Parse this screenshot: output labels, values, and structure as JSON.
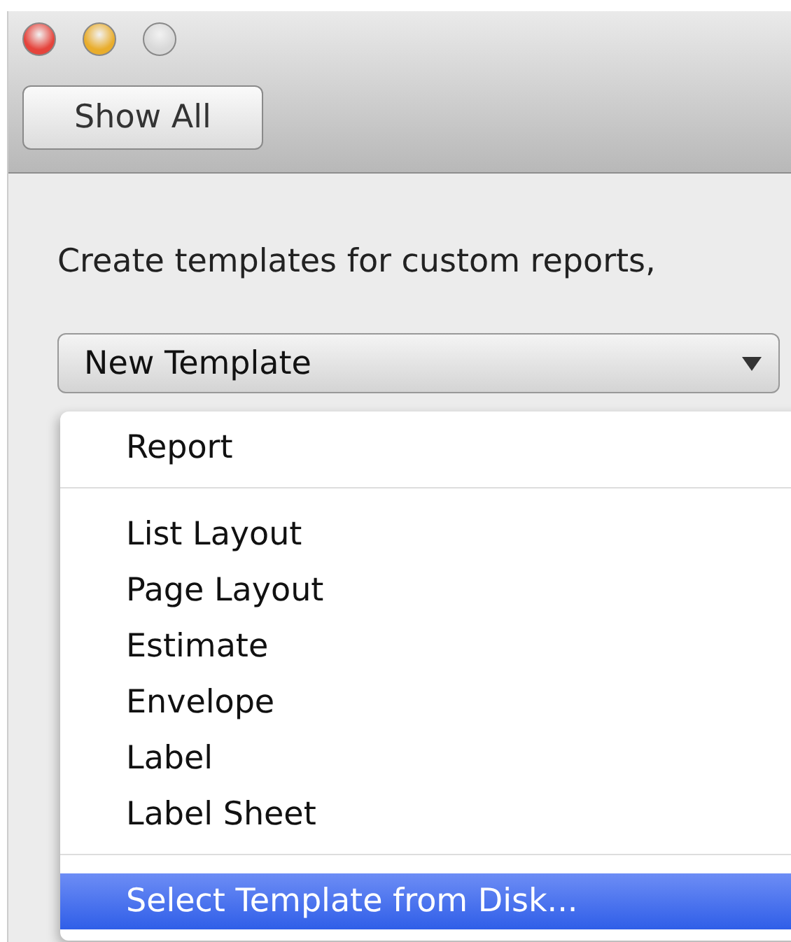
{
  "toolbar": {
    "show_all_button": "Show All"
  },
  "description": "Create templates for custom reports,",
  "template_popup": {
    "value": "New Template",
    "expanded": true
  },
  "menu": [
    {
      "kind": "item",
      "label": "Report",
      "selected": false
    },
    {
      "kind": "separator"
    },
    {
      "kind": "item",
      "label": "List Layout",
      "selected": false
    },
    {
      "kind": "item",
      "label": "Page Layout",
      "selected": false
    },
    {
      "kind": "item",
      "label": "Estimate",
      "selected": false
    },
    {
      "kind": "item",
      "label": "Envelope",
      "selected": false
    },
    {
      "kind": "item",
      "label": "Label",
      "selected": false
    },
    {
      "kind": "item",
      "label": "Label Sheet",
      "selected": false
    },
    {
      "kind": "separator"
    },
    {
      "kind": "item",
      "label": "Select Template from Disk...",
      "selected": true
    }
  ]
}
